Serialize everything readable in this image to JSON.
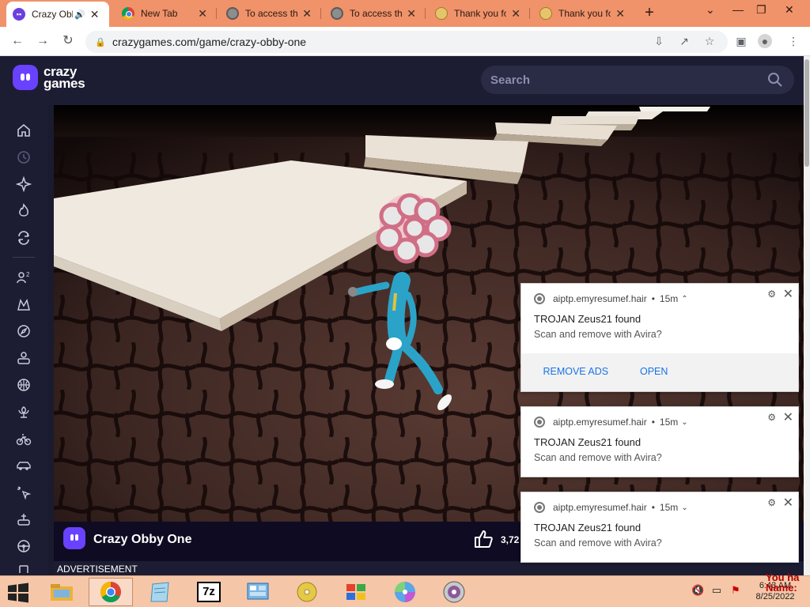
{
  "browser": {
    "tabs": [
      {
        "title": "Crazy Obby One",
        "active": true,
        "favicon": "crazygames-favicon",
        "audio": true
      },
      {
        "title": "New Tab",
        "favicon": "chrome-favicon"
      },
      {
        "title": "To access the",
        "favicon": "globe-favicon"
      },
      {
        "title": "To access the",
        "favicon": "globe-favicon"
      },
      {
        "title": "Thank you fo",
        "favicon": "smile-favicon"
      },
      {
        "title": "Thank you fo",
        "favicon": "smile-favicon"
      }
    ],
    "new_tab_label": "+",
    "url": "crazygames.com/game/crazy-obby-one",
    "tab_strip_color": "#f0926a"
  },
  "site": {
    "logo_top": "crazy",
    "logo_bottom": "games",
    "search_placeholder": "Search",
    "brand_color": "#6842ff",
    "header_bg": "#1c1d33"
  },
  "sidebar": {
    "items": [
      "home-icon",
      "recent-icon",
      "new-icon",
      "trending-icon",
      "updated-icon",
      "multiplayer-icon",
      "action-icon",
      "adventure-icon",
      "casual-icon",
      "sports-icon",
      "flower-icon",
      "bike-icon",
      "car-icon",
      "clicker-icon",
      "puzzle-icon",
      "driving-icon"
    ]
  },
  "game": {
    "title": "Crazy Obby One",
    "likes": "3,72",
    "advertisement_label": "ADVERTISEMENT"
  },
  "notifications": [
    {
      "source": "aiptp.emyresumef.hair",
      "age": "15m",
      "title": "TROJAN Zeus21 found",
      "message": "Scan and remove with Avira?",
      "expanded": true,
      "actions": [
        "⁠ REMOVE ADS",
        "OPEN"
      ]
    },
    {
      "source": "aiptp.emyresumef.hair",
      "age": "15m",
      "title": "TROJAN Zeus21 found",
      "message": "Scan and remove with Avira?",
      "expanded": false
    },
    {
      "source": "aiptp.emyresumef.hair",
      "age": "15m",
      "title": "TROJAN Zeus21 found",
      "message": "Scan and remove with Avira?",
      "expanded": false
    }
  ],
  "taskbar": {
    "apps": [
      "file-explorer-icon",
      "chrome-icon",
      "notepad-icon",
      "7zip-icon",
      "control-panel-icon",
      "cd-icon",
      "windows-logo-icon",
      "media-disc-icon",
      "dvd-icon"
    ],
    "active_app": "chrome-icon",
    "sevenzip_label": "7z",
    "time": "6:43 AM",
    "date": "8/25/2022",
    "overlay_text_1": "You ha",
    "overlay_text_2": "Name:"
  }
}
